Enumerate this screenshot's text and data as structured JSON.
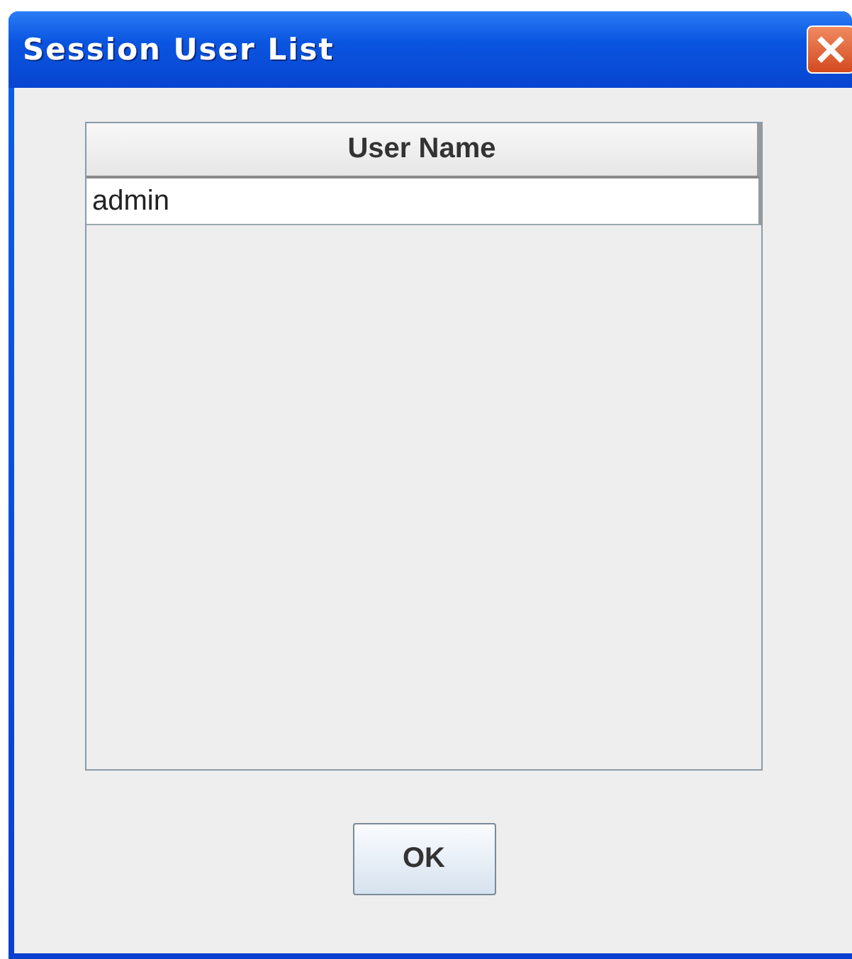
{
  "window": {
    "title": "Session User List"
  },
  "table": {
    "columns": [
      "User Name"
    ],
    "rows": [
      [
        "admin"
      ]
    ]
  },
  "buttons": [
    "OK"
  ]
}
